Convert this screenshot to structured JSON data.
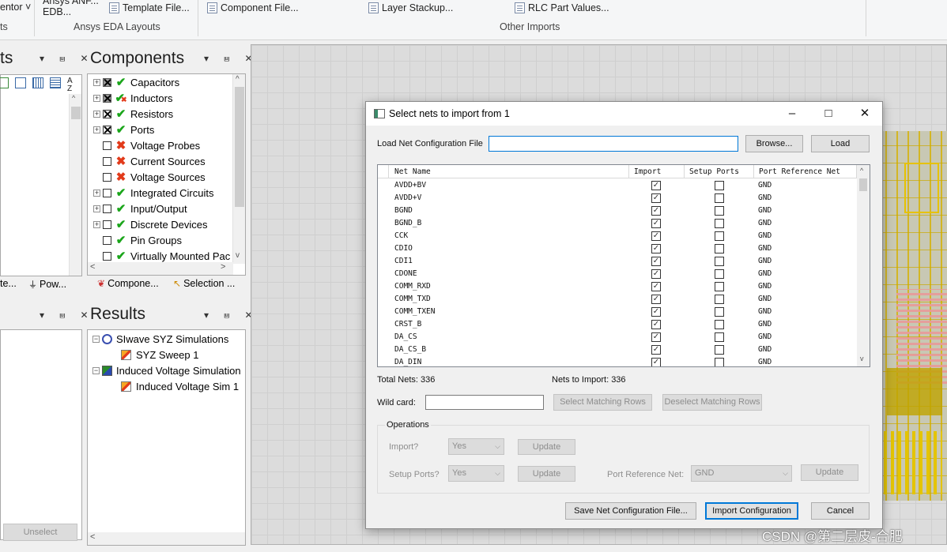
{
  "ribbon": {
    "items": [
      {
        "label": "entor ˅"
      },
      {
        "label": "Ansys ANF..."
      },
      {
        "label": "EDB..."
      },
      {
        "label": "Template File..."
      },
      {
        "label": "Component File..."
      },
      {
        "label": "Layer Stackup..."
      },
      {
        "label": "RLC Part Values..."
      }
    ],
    "groups": [
      "ts",
      "Ansys EDA Layouts",
      "Other Imports"
    ]
  },
  "left_panel": {
    "title": "ts",
    "controls": "▾ ⩏ ✕",
    "tab1": "te...",
    "tab2": "Pow...",
    "controls2": "▾ ⩏ ✕",
    "unselect": "Unselect"
  },
  "components_panel": {
    "title": "Components",
    "controls": "▾ ⩏ ✕",
    "items": [
      {
        "label": "Capacitors",
        "exp": "+",
        "check": "grey",
        "status": "ok"
      },
      {
        "label": "Inductors",
        "exp": "+",
        "check": "grey",
        "status": "mixed"
      },
      {
        "label": "Resistors",
        "exp": "+",
        "check": "x",
        "status": "ok"
      },
      {
        "label": "Ports",
        "exp": "+",
        "check": "x",
        "status": "ok"
      },
      {
        "label": "Voltage Probes",
        "exp": "",
        "check": "empty",
        "status": "bad"
      },
      {
        "label": "Current Sources",
        "exp": "",
        "check": "empty",
        "status": "bad"
      },
      {
        "label": "Voltage Sources",
        "exp": "",
        "check": "empty",
        "status": "bad"
      },
      {
        "label": "Integrated Circuits",
        "exp": "+",
        "check": "empty",
        "status": "ok"
      },
      {
        "label": "Input/Output",
        "exp": "+",
        "check": "empty",
        "status": "ok"
      },
      {
        "label": "Discrete Devices",
        "exp": "+",
        "check": "empty",
        "status": "ok"
      },
      {
        "label": "Pin Groups",
        "exp": "",
        "check": "empty",
        "status": "ok"
      },
      {
        "label": "Virtually Mounted Pac",
        "exp": "",
        "check": "empty",
        "status": "ok"
      }
    ],
    "tab1": "Compone...",
    "tab2": "Selection ..."
  },
  "results_panel": {
    "title": "Results",
    "controls": "▾ ⩏ ✕",
    "items": [
      {
        "label": "SIwave SYZ Simulations",
        "level": 0
      },
      {
        "label": "SYZ Sweep 1",
        "level": 1
      },
      {
        "label": "Induced Voltage Simulation",
        "level": 0
      },
      {
        "label": "Induced Voltage Sim 1",
        "level": 1
      }
    ]
  },
  "dialog": {
    "title": "Select nets to import from 1",
    "load_label": "Load Net Configuration File",
    "load_value": "",
    "browse": "Browse...",
    "load": "Load",
    "columns": [
      "Net Name",
      "Import",
      "Setup Ports",
      "Port Reference Net"
    ],
    "rows": [
      {
        "net": "AVDD+BV",
        "import": true,
        "setup": false,
        "ref": "GND"
      },
      {
        "net": "AVDD+V",
        "import": true,
        "setup": false,
        "ref": "GND"
      },
      {
        "net": "BGND",
        "import": true,
        "setup": false,
        "ref": "GND"
      },
      {
        "net": "BGND_B",
        "import": true,
        "setup": false,
        "ref": "GND"
      },
      {
        "net": "CCK",
        "import": true,
        "setup": false,
        "ref": "GND"
      },
      {
        "net": "CDIO",
        "import": true,
        "setup": false,
        "ref": "GND"
      },
      {
        "net": "CDI1",
        "import": true,
        "setup": false,
        "ref": "GND"
      },
      {
        "net": "CDONE",
        "import": true,
        "setup": false,
        "ref": "GND"
      },
      {
        "net": "COMM_RXD",
        "import": true,
        "setup": false,
        "ref": "GND"
      },
      {
        "net": "COMM_TXD",
        "import": true,
        "setup": false,
        "ref": "GND"
      },
      {
        "net": "COMM_TXEN",
        "import": true,
        "setup": false,
        "ref": "GND"
      },
      {
        "net": "CRST_B",
        "import": true,
        "setup": false,
        "ref": "GND"
      },
      {
        "net": "DA_CS",
        "import": true,
        "setup": false,
        "ref": "GND"
      },
      {
        "net": "DA_CS_B",
        "import": true,
        "setup": false,
        "ref": "GND"
      },
      {
        "net": "DA_DIN",
        "import": true,
        "setup": false,
        "ref": "GND"
      }
    ],
    "total_nets": "Total Nets: 336",
    "nets_to_import": "Nets to Import: 336",
    "wildcard_label": "Wild card:",
    "wildcard_value": "",
    "select_matching": "Select Matching Rows",
    "deselect_matching": "Deselect Matching Rows",
    "operations_label": "Operations",
    "import_label": "Import?",
    "import_value": "Yes",
    "setup_label": "Setup Ports?",
    "setup_value": "Yes",
    "update": "Update",
    "port_ref_label": "Port Reference Net:",
    "port_ref_value": "GND",
    "save_config": "Save Net Configuration File...",
    "import_config": "Import Configuration",
    "cancel": "Cancel"
  },
  "watermark": "CSDN @第二层皮-合肥"
}
